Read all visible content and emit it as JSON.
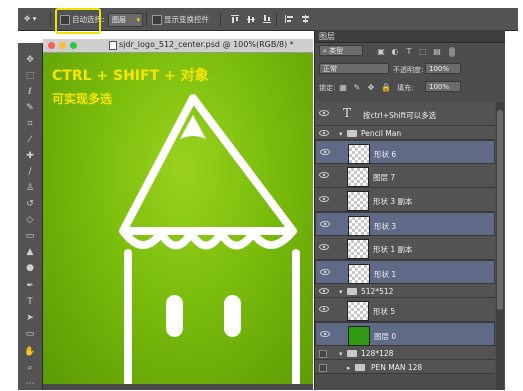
{
  "options_bar": {
    "auto_select_label": "自动选择:",
    "auto_select_target": "图层",
    "show_transform_label": "显示变换控件"
  },
  "document": {
    "title": "sjdr_logo_512_center.psd @ 100%(RGB/8) *"
  },
  "annotations": {
    "line1": "CTRL + SHIFT + 对象",
    "line2": "可实现多选"
  },
  "panel": {
    "tab": "图层",
    "filter_kind": "类型",
    "blend_mode": "正常",
    "opacity_label": "不透明度:",
    "opacity_value": "100%",
    "lock_label": "锁定:",
    "fill_label": "填充:",
    "fill_value": "100%"
  },
  "layers": [
    {
      "type": "text",
      "name": "按ctrl+Shift可以多选",
      "selected": false
    },
    {
      "type": "group",
      "name": "Pencil Man",
      "expanded": true
    },
    {
      "type": "shape",
      "name": "形状 6",
      "selected": true
    },
    {
      "type": "layer",
      "name": "图层 7",
      "selected": false
    },
    {
      "type": "shape",
      "name": "形状 3 副本",
      "selected": false
    },
    {
      "type": "shape",
      "name": "形状 3",
      "selected": true
    },
    {
      "type": "shape",
      "name": "形状 1 副本",
      "selected": false
    },
    {
      "type": "shape",
      "name": "形状 1",
      "selected": true
    },
    {
      "type": "group",
      "name": "512*512",
      "expanded": true
    },
    {
      "type": "shape",
      "name": "形状 5",
      "selected": false
    },
    {
      "type": "fill",
      "name": "图层 0",
      "selected": true
    },
    {
      "type": "group",
      "name": "128*128",
      "expanded": true
    },
    {
      "type": "group",
      "name": "PEN MAN 128",
      "expanded": false
    }
  ],
  "colors": {
    "accent_highlight": "#f2e200",
    "annotation_text": "#f7e600",
    "canvas_green": "#79bc0b",
    "selected_layer": "#5f6b86"
  }
}
